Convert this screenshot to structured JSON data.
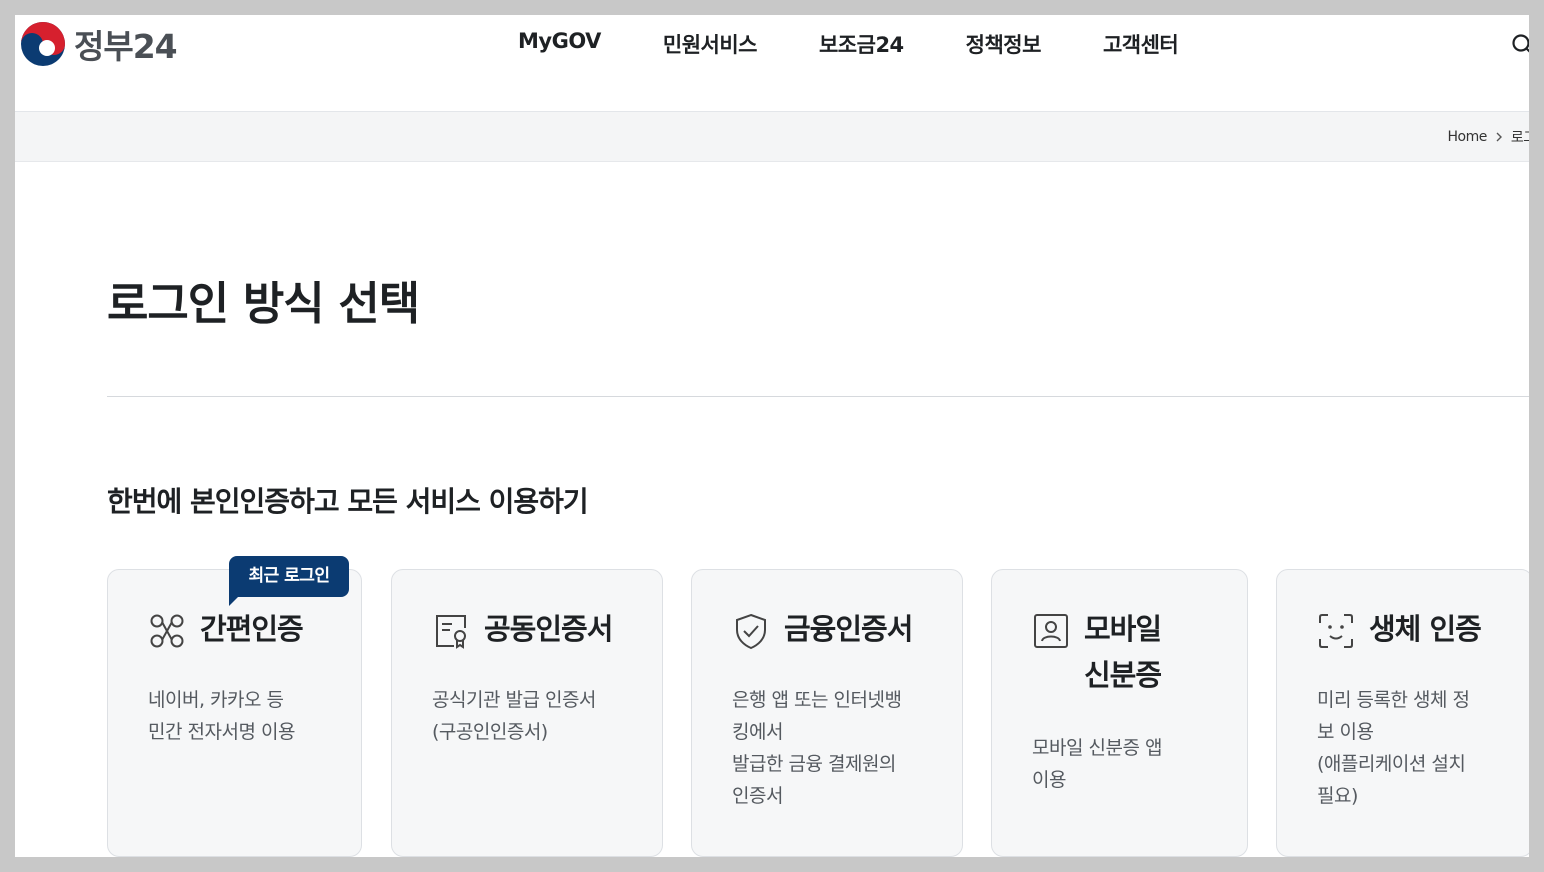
{
  "header": {
    "logo_text": "정부24",
    "nav": [
      "MyGOV",
      "민원서비스",
      "보조금24",
      "정책정보",
      "고객센터"
    ]
  },
  "breadcrumb": {
    "home": "Home",
    "current": "로그인"
  },
  "main": {
    "title": "로그인 방식 선택",
    "section_heading": "한번에 본인인증하고 모든 서비스 이용하기",
    "badge": "최근 로그인",
    "cards": [
      {
        "title": "간편인증",
        "desc": [
          "네이버, 카카오 등",
          "민간 전자서명 이용"
        ],
        "icon": "link-nodes-icon"
      },
      {
        "title": "공동인증서",
        "desc": [
          "공식기관 발급 인증서",
          "(구공인인증서)"
        ],
        "icon": "certificate-icon"
      },
      {
        "title": "금융인증서",
        "desc": [
          "은행 앱 또는 인터넷뱅",
          "킹에서",
          "발급한 금융 결제원의",
          "인증서"
        ],
        "icon": "shield-check-icon"
      },
      {
        "title_lines": [
          "모바일",
          "신분증"
        ],
        "desc": [
          "모바일 신분증 앱",
          "이용"
        ],
        "icon": "id-card-icon"
      },
      {
        "title": "생체 인증",
        "desc": [
          "미리 등록한 생체 정",
          "보 이용",
          "(애플리케이션 설치",
          "필요)"
        ],
        "icon": "face-scan-icon"
      }
    ]
  },
  "colors": {
    "badge": "#0b3b72",
    "card_bg": "#f6f7f8",
    "crumb_bg": "#f4f5f6"
  }
}
